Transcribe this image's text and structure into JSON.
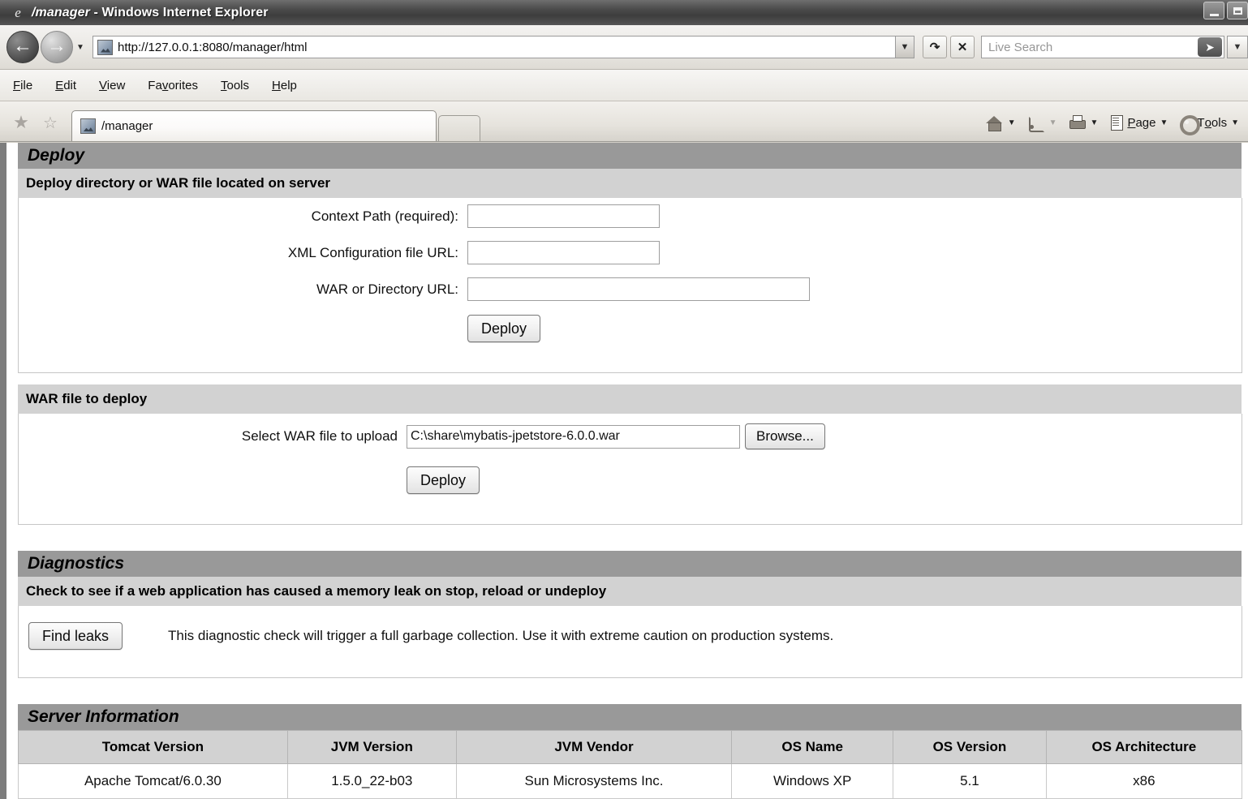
{
  "window": {
    "title_prefix": "/manager",
    "title_suffix": " - Windows Internet Explorer",
    "minimize_label": "Minimize",
    "maximize_label": "Maximize"
  },
  "browser": {
    "back_label": "Back",
    "forward_label": "Forward",
    "history_dropdown_label": "Recent Pages",
    "address": {
      "value": "http://127.0.0.1:8080/manager/html",
      "dropdown_label": "Address dropdown"
    },
    "refresh_label": "Refresh",
    "stop_label": "Stop",
    "search": {
      "placeholder": "Live Search",
      "go_label": "Search",
      "dropdown_label": "Search provider"
    },
    "menu": [
      {
        "label": "File",
        "accel": "F",
        "rest": "ile"
      },
      {
        "label": "Edit",
        "accel": "E",
        "rest": "dit"
      },
      {
        "label": "View",
        "accel": "V",
        "rest": "iew"
      },
      {
        "label": "Favorites",
        "pre": "Fa",
        "accel": "v",
        "rest": "orites"
      },
      {
        "label": "Tools",
        "accel": "T",
        "rest": "ools"
      },
      {
        "label": "Help",
        "accel": "H",
        "rest": "elp"
      }
    ],
    "favorites_center_label": "Favorites Center",
    "add_favorite_label": "Add to Favorites",
    "tabs": [
      {
        "label": "/manager",
        "active": true
      }
    ],
    "new_tab_label": "New Tab",
    "command_bar": {
      "home_label": "Home",
      "feeds_label": "Feeds",
      "print_label": "Print",
      "page_label": "Page",
      "page_pre": "P",
      "page_rest": "age",
      "tools_label": "Tools",
      "tools_pre": "T",
      "tools_accel": "o",
      "tools_rest": "ols"
    }
  },
  "page": {
    "deploy": {
      "title": "Deploy",
      "server_subtitle": "Deploy directory or WAR file located on server",
      "fields": [
        {
          "label": "Context Path (required):",
          "value": "",
          "width": "short"
        },
        {
          "label": "XML Configuration file URL:",
          "value": "",
          "width": "short"
        },
        {
          "label": "WAR or Directory URL:",
          "value": "",
          "width": "long"
        }
      ],
      "deploy_button": "Deploy",
      "war_subtitle": "WAR file to deploy",
      "upload_label": "Select WAR file to upload",
      "upload_value": "C:\\share\\mybatis-jpetstore-6.0.0.war",
      "browse_button": "Browse...",
      "upload_deploy_button": "Deploy"
    },
    "diagnostics": {
      "title": "Diagnostics",
      "subtitle": "Check to see if a web application has caused a memory leak on stop, reload or undeploy",
      "find_leaks_button": "Find leaks",
      "description": "This diagnostic check will trigger a full garbage collection. Use it with extreme caution on production systems."
    },
    "server_information": {
      "title": "Server Information",
      "columns": [
        "Tomcat Version",
        "JVM Version",
        "JVM Vendor",
        "OS Name",
        "OS Version",
        "OS Architecture"
      ],
      "rows": [
        [
          "Apache Tomcat/6.0.30",
          "1.5.0_22-b03",
          "Sun Microsystems Inc.",
          "Windows XP",
          "5.1",
          "x86"
        ]
      ]
    }
  },
  "colors": {
    "section_header": "#999999",
    "section_subheader": "#d2d2d2",
    "page_background": "#ffffff",
    "titlebar": "#4a4a4a"
  }
}
